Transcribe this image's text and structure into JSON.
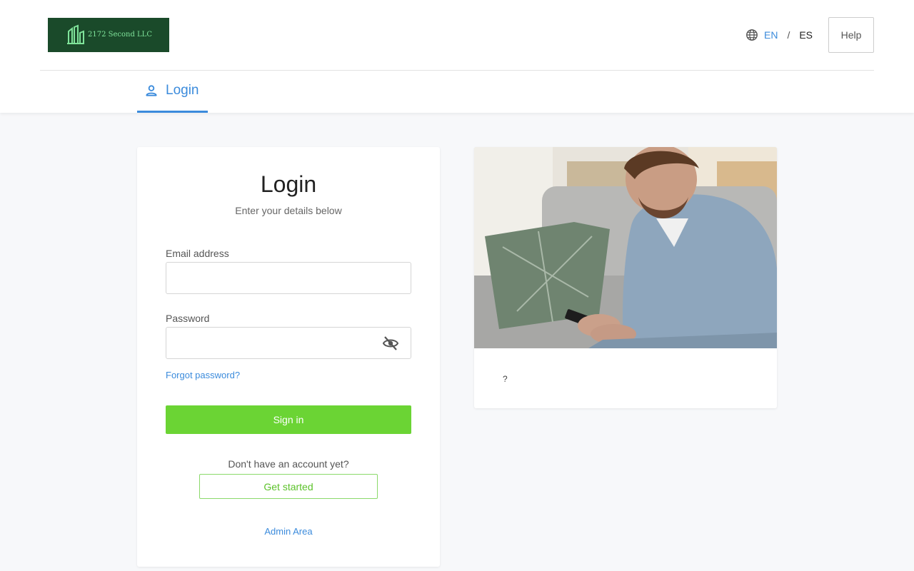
{
  "header": {
    "logo_text": "2172 Second LLC",
    "languages": {
      "en": "EN",
      "separator": "/",
      "es": "ES",
      "active": "EN"
    },
    "help_label": "Help"
  },
  "tabs": [
    {
      "label": "Login",
      "active": true,
      "icon": "user-icon"
    }
  ],
  "login": {
    "title": "Login",
    "subtitle": "Enter your details below",
    "email_label": "Email address",
    "email_value": "",
    "password_label": "Password",
    "password_value": "",
    "forgot_label": "Forgot password?",
    "signin_label": "Sign in",
    "no_account_text": "Don't have an account yet?",
    "get_started_label": "Get started",
    "admin_label": "Admin Area"
  },
  "promo": {
    "caption": "?"
  },
  "colors": {
    "accent_blue": "#3b8bdc",
    "signin_green": "#6bd434",
    "logo_bg": "#1a4a2a"
  }
}
